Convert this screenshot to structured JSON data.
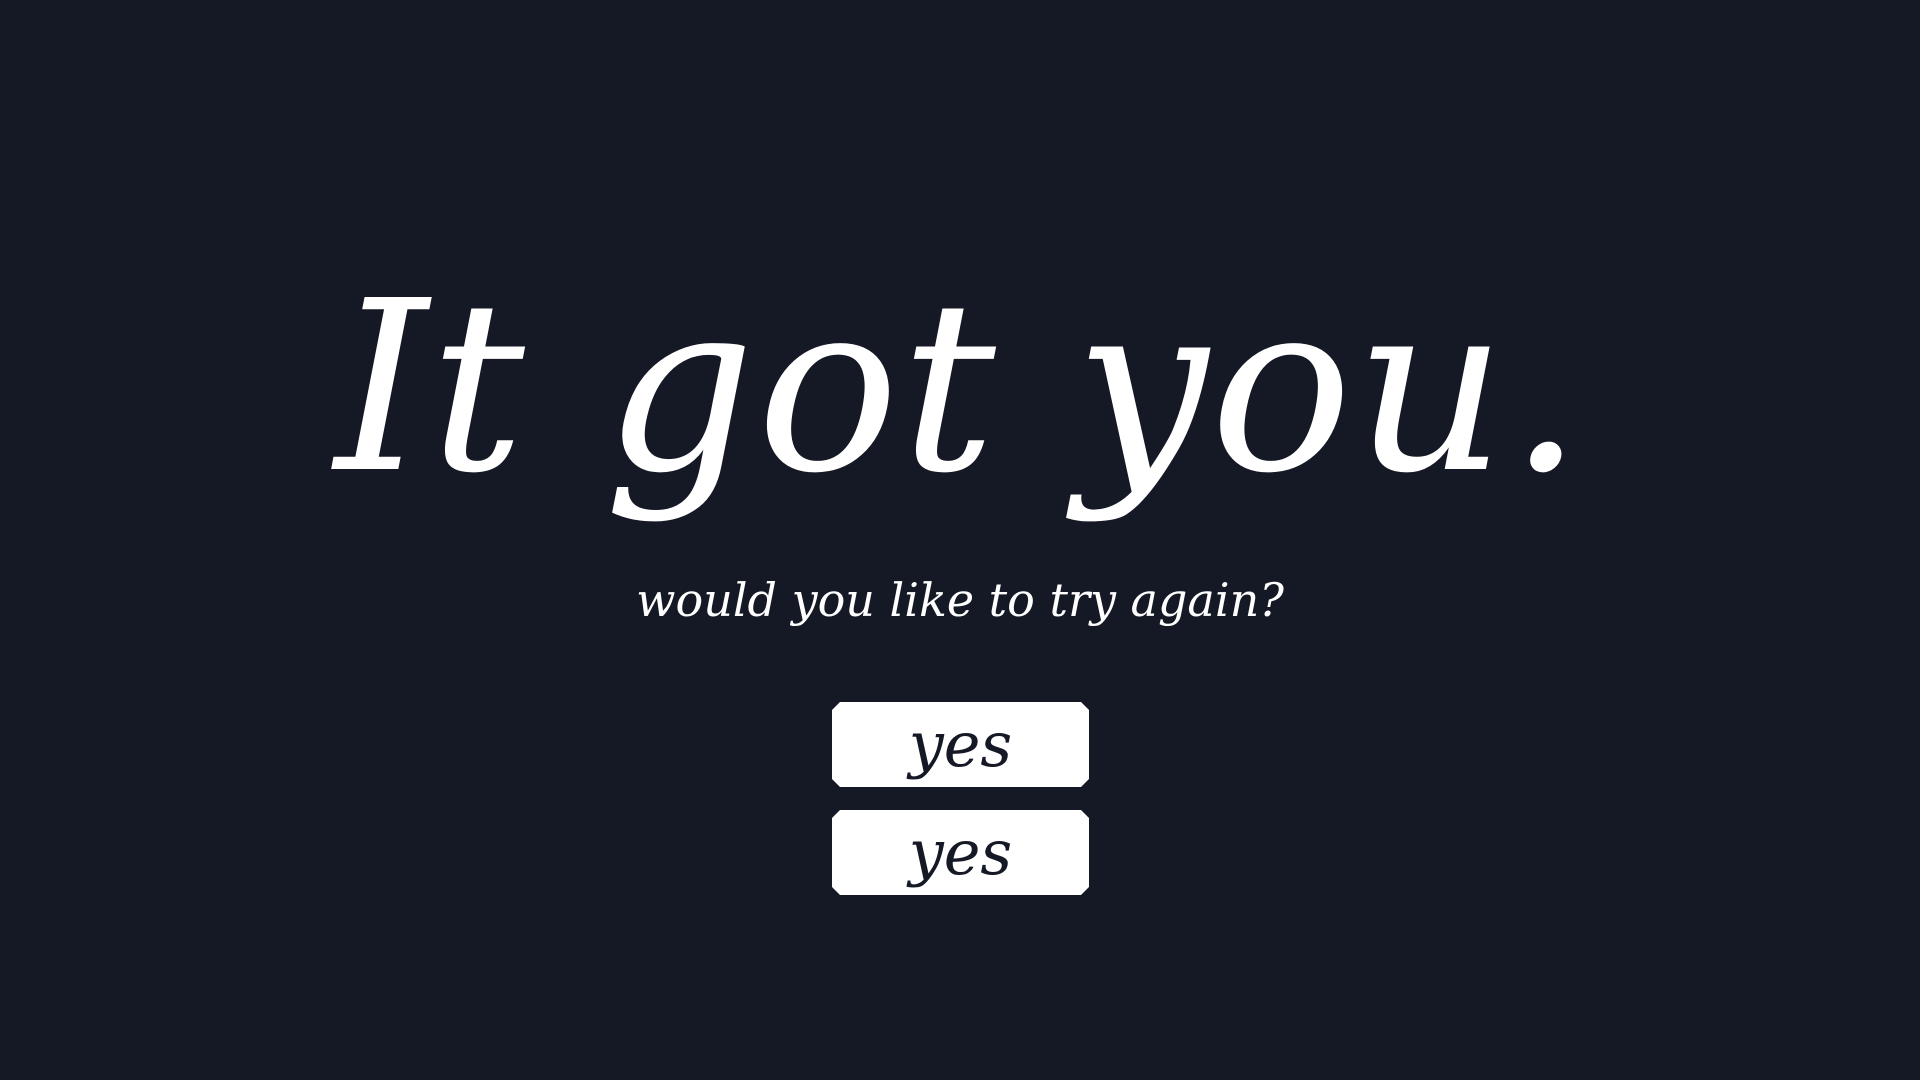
{
  "game_over": {
    "title": "It got you.",
    "prompt": "would you like to try again?",
    "options": [
      {
        "label": "yes"
      },
      {
        "label": "yes"
      }
    ]
  },
  "colors": {
    "background": "#151925",
    "text": "#ffffff",
    "button_fill": "#ffffff",
    "button_text": "#151925"
  }
}
